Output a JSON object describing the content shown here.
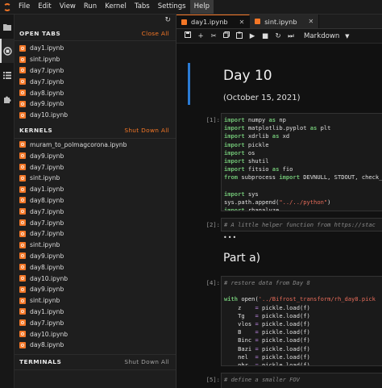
{
  "menubar": {
    "items": [
      "File",
      "Edit",
      "View",
      "Run",
      "Kernel",
      "Tabs",
      "Settings",
      "Help"
    ]
  },
  "sidebar": {
    "open_tabs": {
      "title": "OPEN TABS",
      "action": "Close All",
      "files": [
        "day1.ipynb",
        "sint.ipynb",
        "day7.ipynb",
        "day7.ipynb",
        "day8.ipynb",
        "day9.ipynb",
        "day10.ipynb"
      ]
    },
    "kernels": {
      "title": "KERNELS",
      "action": "Shut Down All",
      "files": [
        "muram_to_polmagcorona.ipynb",
        "day9.ipynb",
        "day7.ipynb",
        "sint.ipynb",
        "day1.ipynb",
        "day8.ipynb",
        "day7.ipynb",
        "day7.ipynb",
        "day7.ipynb",
        "sint.ipynb",
        "day9.ipynb",
        "day8.ipynb",
        "day10.ipynb",
        "day9.ipynb",
        "sint.ipynb",
        "day1.ipynb",
        "day7.ipynb",
        "day10.ipynb",
        "day8.ipynb"
      ]
    },
    "terminals": {
      "title": "TERMINALS",
      "action": "Shut Down All"
    }
  },
  "tabs": [
    {
      "label": "day1.ipynb"
    },
    {
      "label": "sint.ipynb"
    }
  ],
  "toolbar": {
    "cell_type": "Markdown"
  },
  "notebook": {
    "heading": "Day 10",
    "date": "(October 15, 2021)",
    "section": "Part a)",
    "ellipsis": "•••",
    "prompts": {
      "p1": "[1]:",
      "p2": "[2]:",
      "p4": "[4]:",
      "p5": "[5]:"
    },
    "cell2_comment": "# A little helper function from https://stac",
    "cell4_comment": "# restore data from Day 8",
    "cell5_comment": "# define a smaller FOV"
  }
}
